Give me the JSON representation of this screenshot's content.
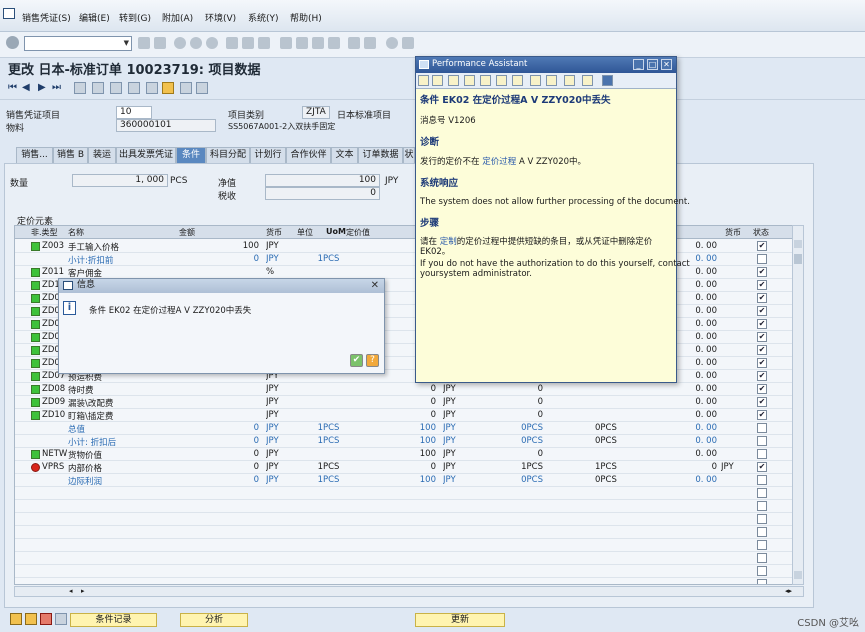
{
  "menu": {
    "items": [
      "销售凭证(S)",
      "编辑(E)",
      "转到(G)",
      "附加(A)",
      "环境(V)",
      "系统(Y)",
      "帮助(H)"
    ]
  },
  "page_title": "更改 日本-标准订单 10023719: 项目数据",
  "header": {
    "item_label": "销售凭证项目",
    "item_value": "10",
    "category_label": "项目类别",
    "category_value": "ZJTA",
    "category_text": "日本标准项目",
    "material_label": "物料",
    "material_value": "360000101",
    "material_desc": "SS5067A001-2入双扶手固定"
  },
  "tabs": [
    "销售...",
    "销售 B",
    "装运",
    "出具发票凭证",
    "条件",
    "科目分配",
    "计划行",
    "合作伙伴",
    "文本",
    "订单数据",
    "状"
  ],
  "active_tab": "条件",
  "qty": {
    "qty_label": "数量",
    "qty_value": "1, 000",
    "qty_unit": "PCS",
    "net_label": "净值",
    "net_value": "100",
    "net_cur": "JPY",
    "tax_label": "税收",
    "tax_value": "0"
  },
  "grid": {
    "section_label": "定价元素",
    "headers": [
      "非.类型",
      "名称",
      "金额",
      "货币",
      "单位",
      "UoM",
      "定价值",
      "货币",
      "状态"
    ],
    "rows": [
      {
        "icon": "green",
        "type": "Z003",
        "name": "手工输入价格",
        "amount": "100",
        "cur": "JPY",
        "unit": "",
        "uom": "",
        "val1": "",
        "val2": "",
        "val3": "",
        "val4": "0. 00",
        "cur2": "",
        "status": true,
        "blue": false
      },
      {
        "icon": "",
        "type": "",
        "name": "小计:折扣前",
        "amount": "0",
        "cur": "JPY",
        "unit": "1",
        "uom": "PCS",
        "val1": "",
        "val2": "",
        "val3": "",
        "val4": "0. 00",
        "cur2": "",
        "status": false,
        "blue": true
      },
      {
        "icon": "green",
        "type": "Z011",
        "name": "客户佣金",
        "amount": "",
        "cur": "%",
        "unit": "",
        "uom": "",
        "val1": "",
        "val2": "",
        "val3": "",
        "val4": "0. 00",
        "cur2": "",
        "status": true,
        "blue": false
      },
      {
        "icon": "green",
        "type": "ZD1",
        "name": "",
        "amount": "",
        "cur": "",
        "unit": "",
        "uom": "",
        "val1": "",
        "val2": "",
        "val3": "",
        "val4": "0. 00",
        "cur2": "",
        "status": true,
        "blue": false
      },
      {
        "icon": "green",
        "type": "ZD0",
        "name": "",
        "amount": "",
        "cur": "",
        "unit": "",
        "uom": "",
        "val1": "",
        "val2": "",
        "val3": "",
        "val4": "0. 00",
        "cur2": "",
        "status": true,
        "blue": false
      },
      {
        "icon": "green",
        "type": "ZD0",
        "name": "",
        "amount": "",
        "cur": "",
        "unit": "",
        "uom": "",
        "val1": "",
        "val2": "",
        "val3": "",
        "val4": "0. 00",
        "cur2": "",
        "status": true,
        "blue": false
      },
      {
        "icon": "green",
        "type": "ZD0",
        "name": "",
        "amount": "",
        "cur": "",
        "unit": "",
        "uom": "",
        "val1": "",
        "val2": "",
        "val3": "",
        "val4": "0. 00",
        "cur2": "",
        "status": true,
        "blue": false
      },
      {
        "icon": "green",
        "type": "ZD0",
        "name": "",
        "amount": "",
        "cur": "",
        "unit": "",
        "uom": "",
        "val1": "",
        "val2": "",
        "val3": "",
        "val4": "0. 00",
        "cur2": "",
        "status": true,
        "blue": false
      },
      {
        "icon": "green",
        "type": "ZD0",
        "name": "",
        "amount": "",
        "cur": "",
        "unit": "",
        "uom": "",
        "val1": "",
        "val2": "",
        "val3": "",
        "val4": "0. 00",
        "cur2": "",
        "status": true,
        "blue": false
      },
      {
        "icon": "green",
        "type": "ZD0",
        "name": "",
        "amount": "",
        "cur": "",
        "unit": "",
        "uom": "",
        "val1": "",
        "val2": "",
        "val3": "",
        "val4": "0. 00",
        "cur2": "",
        "status": true,
        "blue": false
      },
      {
        "icon": "green",
        "type": "ZD07",
        "name": "预运积费",
        "amount": "",
        "cur": "JPY",
        "unit": "",
        "uom": "",
        "val1": "",
        "val2": "",
        "val3": "",
        "val4": "0. 00",
        "cur2": "",
        "status": true,
        "blue": false
      },
      {
        "icon": "green",
        "type": "ZD08",
        "name": "待时费",
        "amount": "",
        "cur": "JPY",
        "unit": "",
        "uom": "",
        "val1": "0",
        "val2": "JPY",
        "val3": "0",
        "val4": "0. 00",
        "cur2": "",
        "status": true,
        "blue": false
      },
      {
        "icon": "green",
        "type": "ZD09",
        "name": "漏装\\改配费",
        "amount": "",
        "cur": "JPY",
        "unit": "",
        "uom": "",
        "val1": "0",
        "val2": "JPY",
        "val3": "0",
        "val4": "0. 00",
        "cur2": "",
        "status": true,
        "blue": false
      },
      {
        "icon": "green",
        "type": "ZD10",
        "name": "盯箱\\插定费",
        "amount": "",
        "cur": "JPY",
        "unit": "",
        "uom": "",
        "val1": "0",
        "val2": "JPY",
        "val3": "0",
        "val4": "0. 00",
        "cur2": "",
        "status": true,
        "blue": false
      },
      {
        "icon": "",
        "type": "",
        "name": "总值",
        "amount": "0",
        "cur": "JPY",
        "unit": "1",
        "uom": "PCS",
        "val1": "100",
        "val2": "JPY",
        "val3": "0PCS",
        "val4": "0. 00",
        "cur2": "",
        "status": false,
        "blue": true
      },
      {
        "icon": "",
        "type": "",
        "name": "小计: 折扣后",
        "amount": "0",
        "cur": "JPY",
        "unit": "1",
        "uom": "PCS",
        "val1": "100",
        "val2": "JPY",
        "val3": "0PCS",
        "val4": "0. 00",
        "cur2": "",
        "status": false,
        "blue": true
      },
      {
        "icon": "green",
        "type": "NETW",
        "name": "货物价值",
        "amount": "0",
        "cur": "JPY",
        "unit": "",
        "uom": "",
        "val1": "100",
        "val2": "JPY",
        "val3": "0",
        "val4": "0. 00",
        "cur2": "",
        "status": false,
        "blue": false
      },
      {
        "icon": "red",
        "type": "VPRS",
        "name": "内部价格",
        "amount": "0",
        "cur": "JPY",
        "unit": "1",
        "uom": "PCS",
        "val1": "0",
        "val2": "JPY",
        "val3": "1PCS",
        "val4": "0",
        "cur2": "JPY",
        "status": true,
        "blue": false
      },
      {
        "icon": "",
        "type": "",
        "name": "边际利润",
        "amount": "0",
        "cur": "JPY",
        "unit": "1",
        "uom": "PCS",
        "val1": "100",
        "val2": "JPY",
        "val3": "0PCS",
        "val4": "0. 00",
        "cur2": "",
        "status": false,
        "blue": true
      }
    ],
    "extra_pcs_col": [
      "",
      "",
      "",
      "",
      "",
      "",
      "",
      "",
      "",
      "",
      "",
      "",
      "",
      "",
      "0PCS",
      "0PCS",
      "",
      "1PCS",
      "0PCS"
    ],
    "empty_rows": 9
  },
  "info_dialog": {
    "title": "信息",
    "message": "条件 EK02 在定价过程A V ZZY020中丢失"
  },
  "performance_assistant": {
    "title": "Performance Assistant",
    "heading": "条件 EK02 在定价过程A V ZZY020中丢失",
    "msgno": "消息号 V1206",
    "diag_h": "诊断",
    "diag_pre": "发行的定价不在",
    "diag_link": "定价过程",
    "diag_post": "A V ZZY020中。",
    "resp_h": "系统响应",
    "resp_text": "The system does not allow further processing of the document.",
    "steps_h": "步骤",
    "steps_pre": "请在",
    "steps_link": "定制",
    "steps_post": "的定价过程中提供短缺的条目，或从凭证中删除定价EK02。",
    "steps_en1": "If you do not have the authorization to do this yourself, contact",
    "steps_en2": "yoursystem administrator."
  },
  "bottom": {
    "cond_rec": "条件记录",
    "analysis": "分析",
    "update": "更新"
  },
  "watermark": "CSDN @艾吆"
}
